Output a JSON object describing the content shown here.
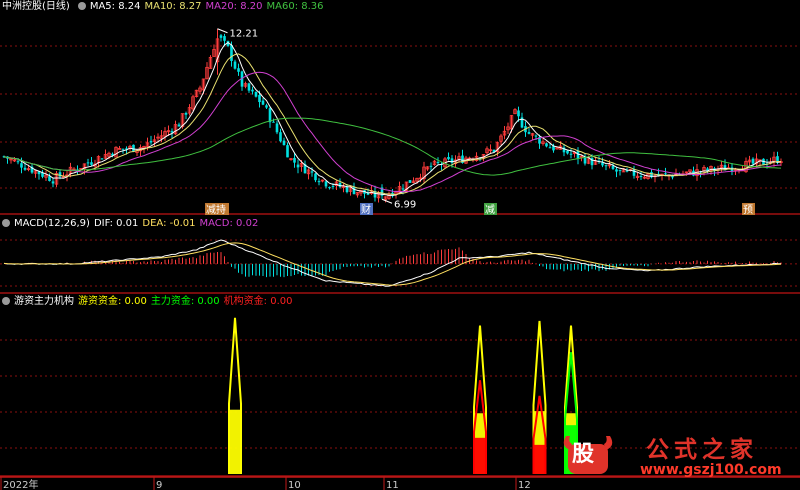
{
  "colors": {
    "bg": "#000000",
    "up": "#ff3c3c",
    "down": "#00e0e0",
    "ma5": "#ffffff",
    "ma10": "#e8e070",
    "ma20": "#d040d0",
    "ma60": "#40c040",
    "grid": "#8a1010",
    "dif": "#ffffff",
    "dea": "#ffe060",
    "youzi": "#ffff00",
    "zhuli": "#00ff00",
    "jigou": "#ff0000"
  },
  "price_panel": {
    "title": "中洲控股(日线)",
    "ma5_label": "MA5: 8.24",
    "ma10_label": "MA10: 8.27",
    "ma20_label": "MA20: 8.20",
    "ma60_label": "MA60: 8.36",
    "high_label": "12.21",
    "low_label": "6.99",
    "markers": [
      "减持",
      "财",
      "减",
      "预"
    ]
  },
  "macd_panel": {
    "title": "MACD(12,26,9)",
    "dif_label": "DIF: 0.01",
    "dea_label": "DEA: -0.01",
    "macd_label": "MACD: 0.02"
  },
  "fund_panel": {
    "title": "游资主力机构",
    "youzi_label": "游资资金: 0.00",
    "zhuli_label": "主力资金: 0.00",
    "jigou_label": "机构资金: 0.00"
  },
  "x_axis": {
    "labels": [
      "2022年",
      "9",
      "10",
      "11",
      "12"
    ]
  },
  "watermark": {
    "logo_text": "股",
    "title": "公式之家",
    "url": "www.gszj100.com"
  },
  "chart_data": [
    {
      "type": "candlestick",
      "title": "中洲控股(日线)",
      "key_points": [
        [
          0,
          8.3
        ],
        [
          8,
          7.9
        ],
        [
          14,
          7.6
        ],
        [
          22,
          8.0
        ],
        [
          32,
          8.5
        ],
        [
          40,
          8.6
        ],
        [
          50,
          9.3
        ],
        [
          56,
          10.4
        ],
        [
          61,
          12.0
        ],
        [
          64,
          11.6
        ],
        [
          68,
          10.5
        ],
        [
          74,
          9.9
        ],
        [
          82,
          8.2
        ],
        [
          92,
          7.5
        ],
        [
          102,
          7.2
        ],
        [
          108,
          7.05
        ],
        [
          114,
          7.4
        ],
        [
          122,
          8.0
        ],
        [
          130,
          8.2
        ],
        [
          140,
          8.5
        ],
        [
          146,
          9.6
        ],
        [
          150,
          9.0
        ],
        [
          156,
          8.6
        ],
        [
          164,
          8.3
        ],
        [
          176,
          7.8
        ],
        [
          188,
          7.7
        ],
        [
          196,
          7.8
        ],
        [
          206,
          7.95
        ],
        [
          216,
          8.1
        ],
        [
          222,
          8.24
        ]
      ],
      "high": 12.21,
      "low": 6.99,
      "ma_values_last": {
        "MA5": 8.24,
        "MA10": 8.27,
        "MA20": 8.2,
        "MA60": 8.36
      },
      "ylim": [
        6.6,
        12.6
      ]
    },
    {
      "type": "line",
      "title": "MACD(12,26,9)",
      "key_points": [
        [
          0,
          0
        ],
        [
          20,
          0
        ],
        [
          45,
          0.25
        ],
        [
          55,
          0.5
        ],
        [
          62,
          0.85
        ],
        [
          70,
          0.45
        ],
        [
          80,
          -0.05
        ],
        [
          92,
          -0.6
        ],
        [
          110,
          -0.8
        ],
        [
          122,
          -0.3
        ],
        [
          130,
          0.2
        ],
        [
          140,
          0.25
        ],
        [
          150,
          0.4
        ],
        [
          160,
          0.15
        ],
        [
          172,
          -0.15
        ],
        [
          184,
          -0.25
        ],
        [
          200,
          -0.1
        ],
        [
          222,
          0.01
        ]
      ],
      "last": {
        "DIF": 0.01,
        "DEA": -0.01,
        "MACD": 0.02
      },
      "ylim": [
        -1.0,
        1.2
      ]
    },
    {
      "type": "bar",
      "title": "游资主力机构",
      "x": [
        66,
        136,
        153,
        162
      ],
      "series": [
        {
          "name": "游资资金",
          "values": [
            1.0,
            0.95,
            0.98,
            0.95
          ]
        },
        {
          "name": "主力资金",
          "values": [
            0,
            0,
            0,
            0.78
          ]
        },
        {
          "name": "机构资金",
          "values": [
            0,
            0.6,
            0.5,
            0
          ]
        }
      ],
      "last": {
        "游资资金": 0.0,
        "主力资金": 0.0,
        "机构资金": 0.0
      },
      "ylim": [
        0,
        1.05
      ]
    }
  ]
}
